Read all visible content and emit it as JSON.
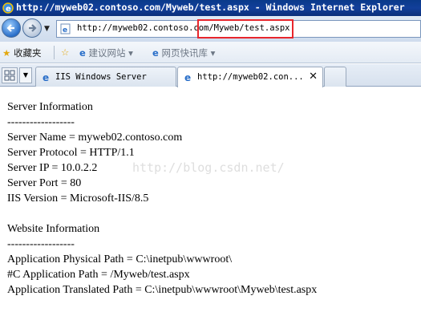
{
  "window": {
    "title": "http://myweb02.contoso.com/Myweb/test.aspx - Windows Internet Explorer"
  },
  "nav": {
    "url": "http://myweb02.contoso.com/Myweb/test.aspx"
  },
  "favorites": {
    "label": "收藏夹",
    "items": [
      {
        "label": "建议网站 ▾",
        "icon": "ie-page-icon"
      },
      {
        "label": "网页快讯库 ▾",
        "icon": "ie-page-icon"
      }
    ]
  },
  "tabs": [
    {
      "label": "IIS Windows Server",
      "active": false
    },
    {
      "label": "http://myweb02.con...",
      "active": true
    }
  ],
  "page": {
    "lines": [
      "Server Information",
      "------------------",
      "Server Name = myweb02.contoso.com",
      "Server Protocol = HTTP/1.1",
      "Server IP = 10.0.2.2",
      "Server Port = 80",
      "IIS Version = Microsoft-IIS/8.5",
      "",
      "Website Information",
      "------------------",
      "Application Physical Path = C:\\inetpub\\wwwroot\\",
      "#C Application Path = /Myweb/test.aspx",
      "Application Translated Path = C:\\inetpub\\wwwroot\\Myweb\\test.aspx"
    ],
    "watermark": "http://blog.csdn.net/"
  },
  "colors": {
    "titlebar": "#0b3a8c",
    "highlight": "#e8262c"
  }
}
